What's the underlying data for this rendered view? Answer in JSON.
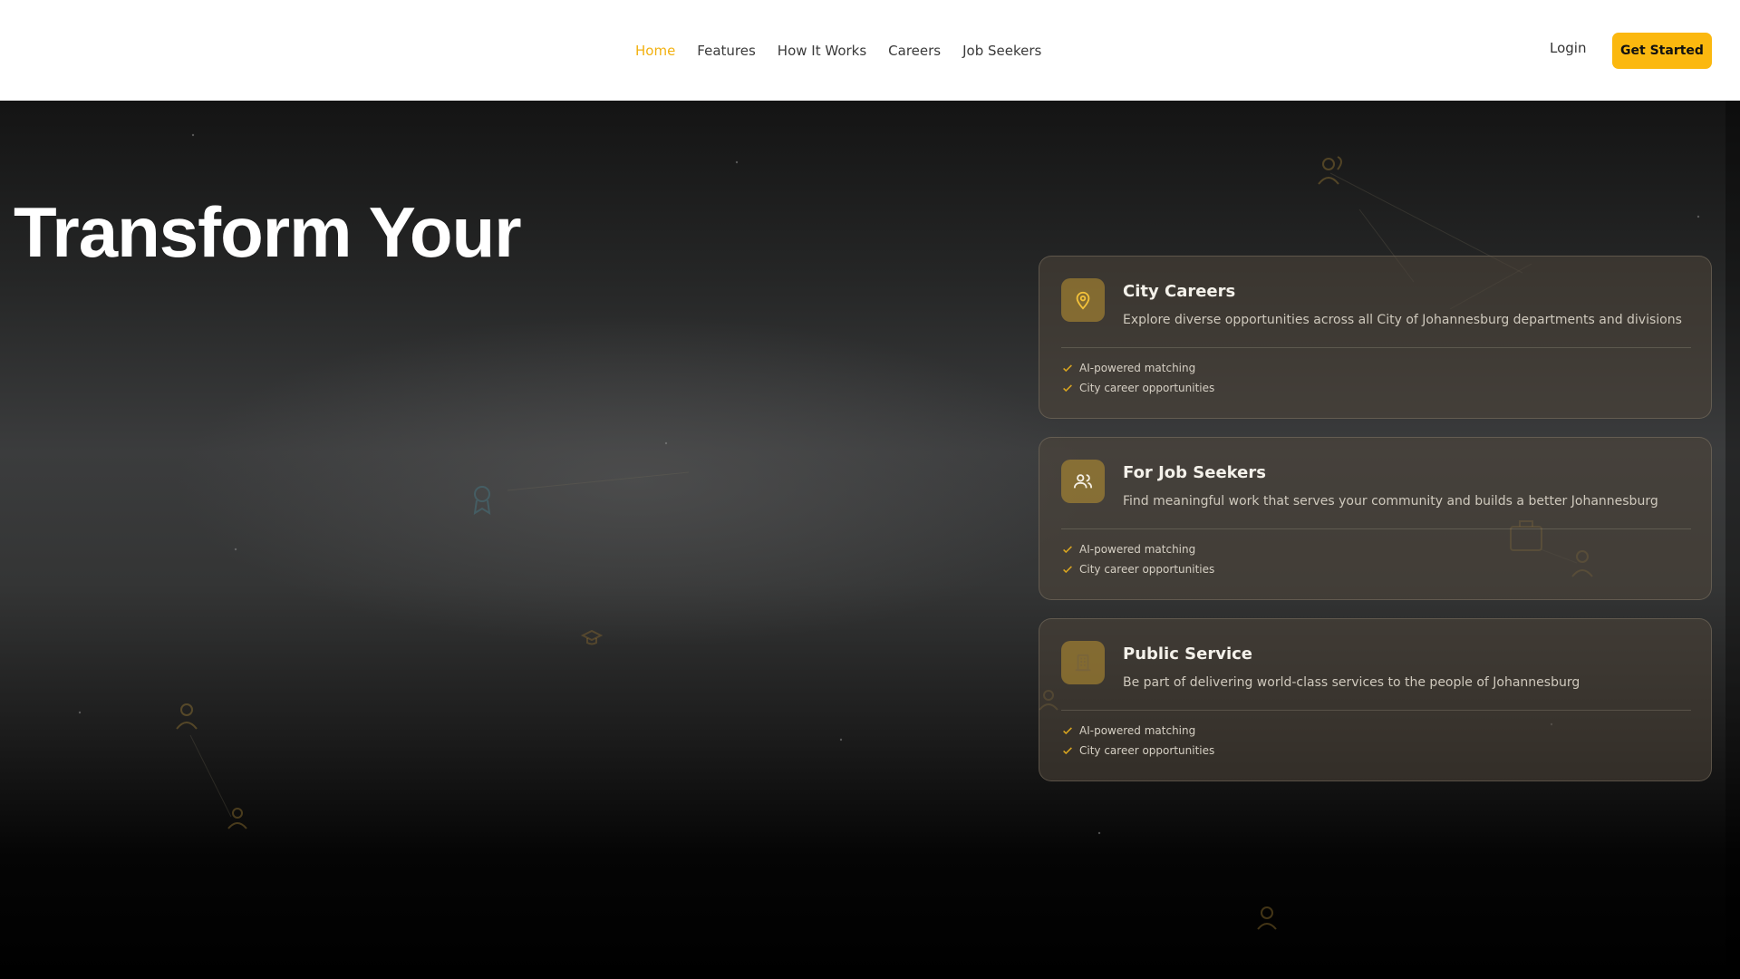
{
  "nav": {
    "links": [
      "Home",
      "Features",
      "How It Works",
      "Careers",
      "Job Seekers"
    ],
    "active": "Home",
    "login_label": "Login",
    "cta_label": "Get Started"
  },
  "hero": {
    "headline": "Transform Your"
  },
  "cards": [
    {
      "icon": "map-pin-icon",
      "title": "City Careers",
      "description": "Explore diverse opportunities across all City of Johannesburg departments and divisions",
      "features": [
        "AI-powered matching",
        "City career opportunities"
      ]
    },
    {
      "icon": "users-icon",
      "title": "For Job Seekers",
      "description": "Find meaningful work that serves your community and builds a better Johannesburg",
      "features": [
        "AI-powered matching",
        "City career opportunities"
      ]
    },
    {
      "icon": "building-icon",
      "title": "Public Service",
      "description": "Be part of delivering world-class services to the people of Johannesburg",
      "features": [
        "AI-powered matching",
        "City career opportunities"
      ]
    }
  ],
  "colors": {
    "accent": "#fbb80f",
    "active_link": "#f2b111",
    "icon_gold": "#f4c23a"
  }
}
